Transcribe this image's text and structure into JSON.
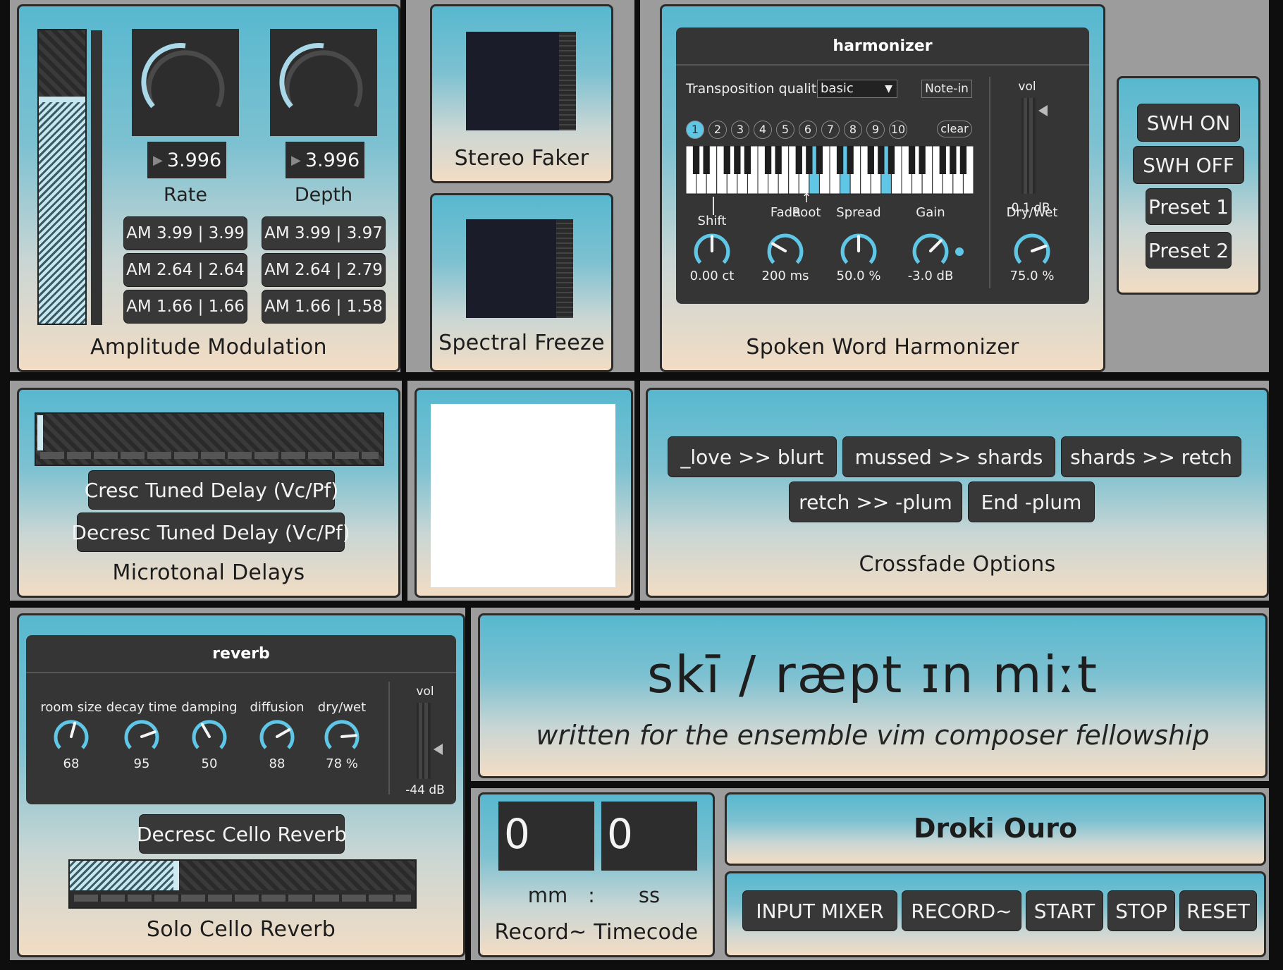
{
  "amp_mod": {
    "title": "Amplitude Modulation",
    "rate_value": "3.996",
    "depth_value": "3.996",
    "rate_label": "Rate",
    "depth_label": "Depth",
    "rate_presets": [
      "AM 3.99 | 3.99",
      "AM 2.64 | 2.64",
      "AM 1.66 | 1.66"
    ],
    "depth_presets": [
      "AM 3.99 | 3.97",
      "AM 2.64 | 2.79",
      "AM 1.66 | 1.58"
    ]
  },
  "stereo_faker": {
    "title": "Stereo Faker"
  },
  "spectral_freeze": {
    "title": "Spectral Freeze"
  },
  "harmonizer": {
    "title": "Spoken Word Harmonizer",
    "device_title": "harmonizer",
    "quality_label": "Transposition quality",
    "quality_value": "basic",
    "note_in": "Note-in",
    "voices": [
      "1",
      "2",
      "3",
      "4",
      "5",
      "6",
      "7",
      "8",
      "9",
      "10"
    ],
    "active_voice": "1",
    "clear": "clear",
    "root_label": "Root",
    "vol_label": "vol",
    "vol_value": "-0.1 dB",
    "knobs": [
      {
        "label": "Shift",
        "value": "0.00 ct"
      },
      {
        "label": "Fade",
        "value": "200 ms"
      },
      {
        "label": "Spread",
        "value": "50.0 %"
      },
      {
        "label": "Gain",
        "value": "-3.0 dB"
      },
      {
        "label": "Dry/Wet",
        "value": "75.0 %"
      }
    ]
  },
  "swh": {
    "buttons": [
      "SWH ON",
      "SWH OFF",
      "Preset 1",
      "Preset 2"
    ]
  },
  "delays": {
    "title": "Microtonal Delays",
    "buttons": [
      "Cresc Tuned Delay (Vc/Pf)",
      "Decresc Tuned Delay (Vc/Pf)"
    ]
  },
  "crossfade": {
    "title": "Crossfade Options",
    "row1": [
      "_love >> blurt",
      "mussed >> shards",
      "shards >> retch"
    ],
    "row2": [
      "retch >> -plum",
      "End -plum"
    ]
  },
  "reverb": {
    "title": "Solo Cello Reverb",
    "device_title": "reverb",
    "button": "Decresc Cello Reverb",
    "vol_label": "vol",
    "vol_value": "-44 dB",
    "level": 0.3,
    "knobs": [
      {
        "label": "room size",
        "value": "68"
      },
      {
        "label": "decay time",
        "value": "95"
      },
      {
        "label": "damping",
        "value": "50"
      },
      {
        "label": "diffusion",
        "value": "88"
      },
      {
        "label": "dry/wet",
        "value": "78 %"
      }
    ]
  },
  "piece": {
    "title": "skī / ræpt ɪn miːt",
    "subtitle": "written for the ensemble vim composer fellowship"
  },
  "timecode": {
    "title": "Record~ Timecode",
    "mm_value": "0",
    "ss_value": "0",
    "mm_label": "mm",
    "colon": ":",
    "ss_label": "ss"
  },
  "performer": {
    "name": "Droki Ouro"
  },
  "transport": {
    "buttons": [
      "INPUT MIXER",
      "RECORD~",
      "START",
      "STOP",
      "RESET"
    ]
  },
  "colors": {
    "accent": "#5fc6e6",
    "panel_top": "#57b8cf",
    "panel_bottom": "#f2dcc4",
    "button": "#383838"
  }
}
